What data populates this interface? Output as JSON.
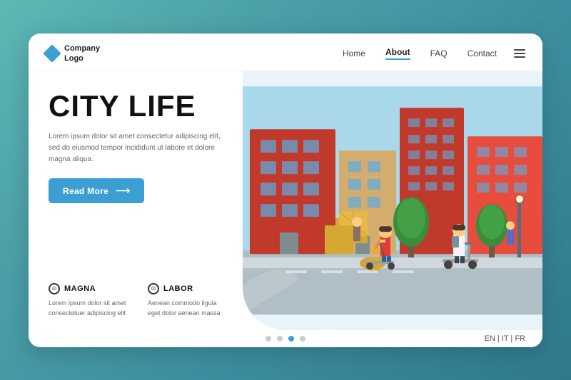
{
  "logo": {
    "line1": "Company",
    "line2": "Logo"
  },
  "nav": {
    "home": "Home",
    "about": "About",
    "faq": "FAQ",
    "contact": "Contact"
  },
  "hero": {
    "title": "CITY LIFE",
    "body": "Lorem ipsum dolor sit amet consectetur adipiscing elit, sed do eiusmod tempor incididunt ut labore et dolore magna aliqua.",
    "read_more": "Read More"
  },
  "features": [
    {
      "title": "MAGNA",
      "body": "Lorem ipsum dolor sit amet consectetuer adipiscing elit"
    },
    {
      "title": "LABOR",
      "body": "Aenean commodo ligula eget dolor aenean massa"
    }
  ],
  "dots": {
    "count": 4,
    "active": 2
  },
  "lang": "EN | IT | FR"
}
